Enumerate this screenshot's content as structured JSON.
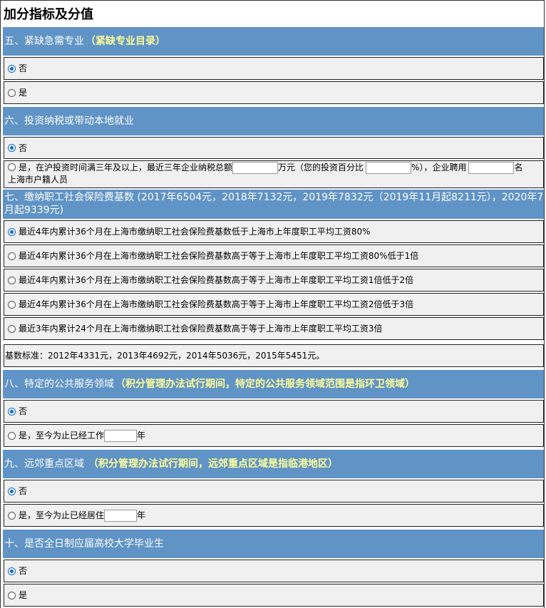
{
  "page_title": "加分指标及分值",
  "colors": {
    "section_bg": "#6093c6",
    "note_text": "#ffff99",
    "row_bg": "#f0f0f0",
    "radio_checked": "#0a66d4"
  },
  "sec5": {
    "title": "五、紧缺急需专业",
    "note": "（紧缺专业目录）",
    "opt_no": "否",
    "opt_yes": "是"
  },
  "sec6": {
    "title": "六、投资纳税或带动本地就业",
    "opt_no": "否",
    "opt_yes_prefix": "是，在沪投资时间满三年及以上，最近三年企业纳税总额",
    "unit_wan": "万元",
    "pct_prefix": "（您的投资百分比",
    "pct_suffix": "%），企业聘用",
    "person_suffix": "名",
    "line2": "上海市户籍人员",
    "tax_value": "",
    "pct_value": "",
    "hire_value": ""
  },
  "sec7": {
    "title": "七、缴纳职工社会保险费基数 (2017年6504元，2018年7132元，2019年7832元（2019年11月起8211元），2020年7月起9339元)",
    "opt1": "最近4年内累计36个月在上海市缴纳职工社会保险费基数低于上海市上年度职工平均工资80%",
    "opt2": "最近4年内累计36个月在上海市缴纳职工社会保险费基数高于等于上海市上年度职工平均工资80%低于1倍",
    "opt3": "最近4年内累计36个月在上海市缴纳职工社会保险费基数高于等于上海市上年度职工平均工资1倍低于2倍",
    "opt4": "最近4年内累计36个月在上海市缴纳职工社会保险费基数高于等于上海市上年度职工平均工资2倍低于3倍",
    "opt5": "最近3年内累计24个月在上海市缴纳职工社会保险费基数高于等于上海市上年度职工平均工资3倍",
    "base_note": "基数标准：2012年4331元，2013年4692元，2014年5036元，2015年5451元。"
  },
  "sec8": {
    "title": "八、特定的公共服务领域",
    "note": "（积分管理办法试行期间，特定的公共服务领域范围是指环卫领域）",
    "opt_no": "否",
    "opt_yes_prefix": "是，至今为止已经工作",
    "unit": "年",
    "years_value": ""
  },
  "sec9": {
    "title": "九、远郊重点区域",
    "note": "（积分管理办法试行期间，远郊重点区域是指临港地区）",
    "opt_no": "否",
    "opt_yes_prefix": "是，至今为止已经居住",
    "unit": "年",
    "years_value": ""
  },
  "sec10": {
    "title": "十、是否全日制应届高校大学毕业生",
    "opt_no": "否",
    "opt_yes": "是"
  }
}
